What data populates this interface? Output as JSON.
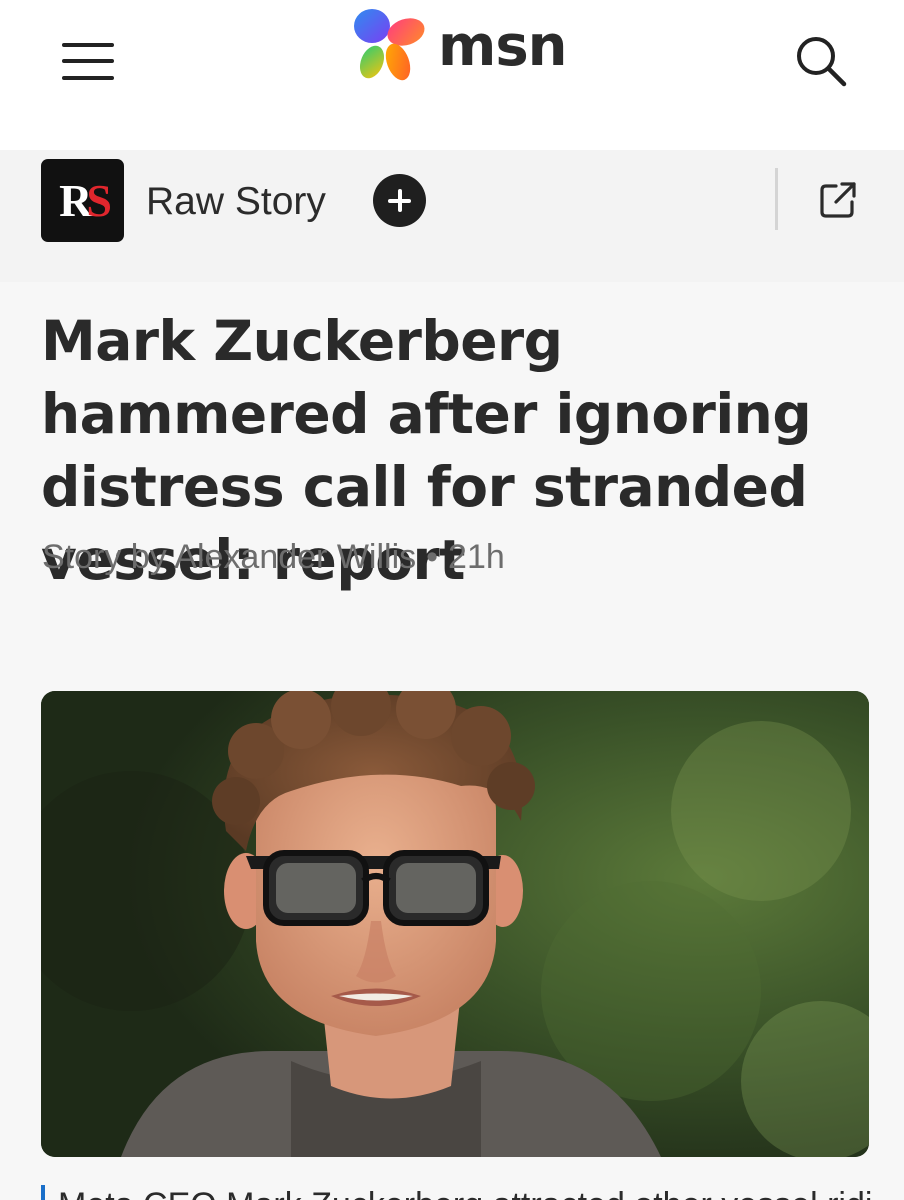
{
  "header": {
    "menu_icon": "hamburger-menu-icon",
    "brand_logo": "msn-butterfly-logo",
    "brand_name": "msn",
    "search_icon": "search-icon"
  },
  "publisher": {
    "logo_text_r": "R",
    "logo_text_s": "S",
    "name": "Raw Story",
    "follow_icon": "plus-icon",
    "share_icon": "open-external-icon"
  },
  "article": {
    "headline": "Mark Zuckerberg hammered after ignoring distress call for stranded vessel: report",
    "byline_prefix": "Story by Alexander Willis",
    "byline_separator": "•",
    "byline_time": "21h",
    "hero_image": "photo-of-man-in-sunglasses",
    "first_line": "Meta CEO Mark Zuckerberg attracted other vessel ridi"
  },
  "colors": {
    "accent_blue": "#1a6fc9",
    "raw_story_red": "#e0262d",
    "background": "#f7f7f7"
  }
}
